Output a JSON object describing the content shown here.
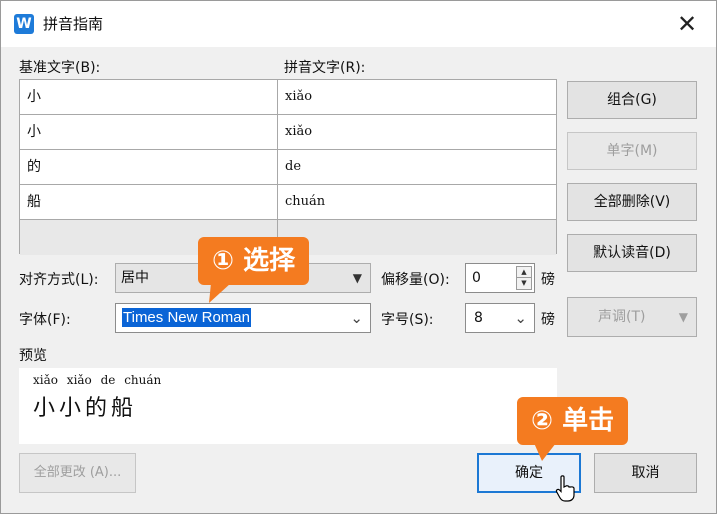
{
  "window": {
    "title": "拼音指南",
    "icon": "wps-writer-icon",
    "close_glyph": "✕"
  },
  "labels": {
    "base_text": "基准文字(B):",
    "pinyin_text": "拼音文字(R):",
    "align": "对齐方式(L):",
    "offset": "偏移量(O):",
    "font": "字体(F):",
    "size": "字号(S):",
    "preview": "预览",
    "unit1": "磅",
    "unit2": "磅"
  },
  "rows": [
    {
      "base": "小",
      "pinyin": "xiǎo"
    },
    {
      "base": "小",
      "pinyin": "xiǎo"
    },
    {
      "base": "的",
      "pinyin": "de"
    },
    {
      "base": "船",
      "pinyin": "chuán"
    },
    {
      "base": "",
      "pinyin": ""
    }
  ],
  "buttons": {
    "group": "组合(G)",
    "single": "单字(M)",
    "delete_all": "全部删除(V)",
    "default_reading": "默认读音(D)",
    "tone": "声调(T)",
    "change_all": "全部更改 (A)...",
    "ok": "确定",
    "cancel": "取消"
  },
  "fields": {
    "align_value": "居中",
    "offset_value": "0",
    "font_value": "Times New Roman",
    "size_value": "8"
  },
  "preview": {
    "pinyin": "xiǎo xiǎo de chuán",
    "hanzi": "小小的船"
  },
  "callouts": {
    "step1": "① 选择",
    "step2": "② 单击"
  },
  "colors": {
    "callout": "#f47b20",
    "selection": "#0a64d6",
    "primary_border": "#1c78d4"
  }
}
